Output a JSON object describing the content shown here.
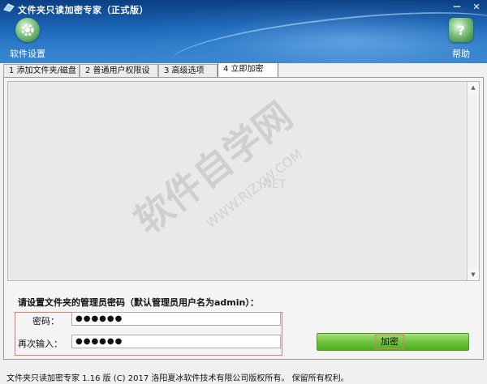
{
  "window": {
    "title": "文件夹只读加密专家（正式版）",
    "controls": {
      "minimize": "－",
      "close": "✕"
    }
  },
  "toolbar": {
    "settings_label": "软件设置",
    "help_label": "帮助"
  },
  "tabs": [
    {
      "label": "1 添加文件夹/磁盘"
    },
    {
      "label": "2 普通用户权限设置"
    },
    {
      "label": "3 高级选项"
    },
    {
      "label": "4 立即加密"
    }
  ],
  "form": {
    "prompt": "请设置文件夹的管理员密码（默认管理员用户名为admin）：",
    "password_label": "密码：",
    "password_value": "●●●●●●",
    "confirm_label": "再次输入：",
    "confirm_value": "●●●●●●",
    "encrypt_button": "加密"
  },
  "status_bar": {
    "text": "文件夹只读加密专家 1.16 版 (C) 2017 洛阳夏冰软件技术有限公司版权所有。 保留所有权利。"
  },
  "watermark": {
    "text": "软件自学网",
    "url": "WWW.RJZXW.COM",
    "net": ".NET"
  },
  "colors": {
    "header": "#1b66b8",
    "button_green": "#6fc33c",
    "highlight_red": "#e0786a"
  }
}
